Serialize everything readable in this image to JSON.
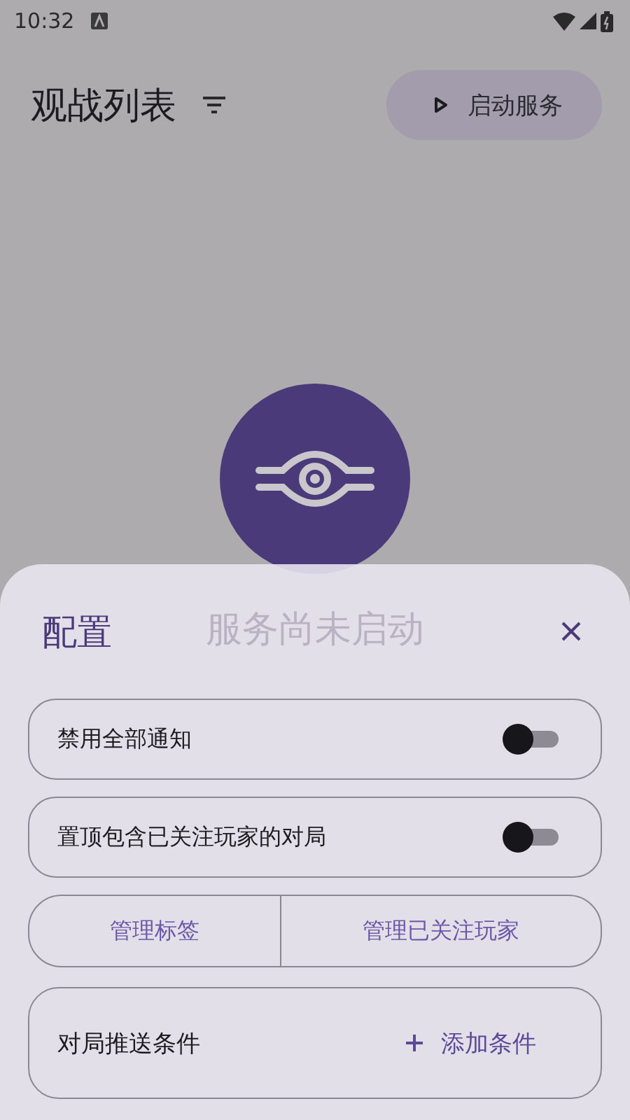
{
  "status_bar": {
    "time": "10:32"
  },
  "header": {
    "title": "观战列表",
    "start_button": "启动服务"
  },
  "empty_state": {
    "message": "服务尚未启动"
  },
  "sheet": {
    "title": "配置",
    "toggles": [
      {
        "label": "禁用全部通知",
        "on": false
      },
      {
        "label": "置顶包含已关注玩家的对局",
        "on": false
      }
    ],
    "buttons": [
      "管理标签",
      "管理已关注玩家"
    ],
    "conditions": {
      "label": "对局推送条件",
      "add_button": "添加条件"
    }
  }
}
